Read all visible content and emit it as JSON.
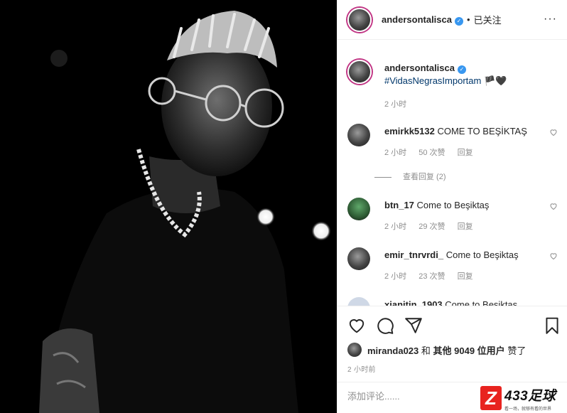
{
  "header": {
    "username": "andersontalisca",
    "verified_mark": "✓",
    "dot": "•",
    "follow_status": "已关注",
    "more_icon": "···"
  },
  "caption": {
    "username": "andersontalisca",
    "hashtag": "#VidasNegrasImportam",
    "emoji": "🏴🖤",
    "time": "2 小时"
  },
  "comments": [
    {
      "username": "emirkk5132",
      "text": "COME TO BEŞİKTAŞ",
      "time": "2 小时",
      "likes": "50 次赞",
      "reply": "回复",
      "view_replies": "查看回复 (2)"
    },
    {
      "username": "btn_17",
      "text": "Come to Beşiktaş",
      "time": "2 小时",
      "likes": "29 次赞",
      "reply": "回复"
    },
    {
      "username": "emir_tnrvrdi_",
      "text": "Come to Beşiktaş",
      "time": "2 小时",
      "likes": "23 次赞",
      "reply": "回复"
    },
    {
      "username": "xianitin_1903",
      "text": "Come to Beşiktaş"
    }
  ],
  "likes": {
    "user": "miranda023",
    "and": "和",
    "others": "其他 9049 位用户",
    "liked": "赞了"
  },
  "time_ago": "2 小时前",
  "add_comment": {
    "placeholder": "添加评论......"
  },
  "watermark": {
    "mark": "Z",
    "brand": "433足球",
    "slogan": "看一场，就够有看的世界"
  },
  "colors": {
    "accent": "#3897f0",
    "text": "#262626",
    "muted": "#8e8e8e",
    "ring": "#c13584",
    "watermark_red": "#e8231f"
  }
}
